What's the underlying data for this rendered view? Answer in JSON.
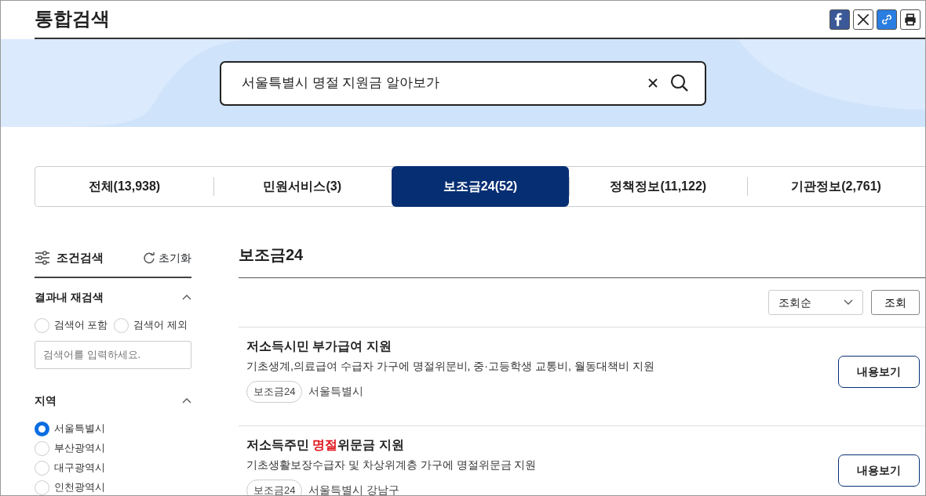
{
  "page_title": "통합검색",
  "share_buttons": [
    {
      "kind": "facebook"
    },
    {
      "kind": "x"
    },
    {
      "kind": "link"
    },
    {
      "kind": "print"
    }
  ],
  "search": {
    "value": "서울특별시 명절 지원금 알아보가"
  },
  "tabs": [
    {
      "label": "전체(13,938)",
      "selected": false
    },
    {
      "label": "민원서비스(3)",
      "selected": false
    },
    {
      "label": "보조금24(52)",
      "selected": true
    },
    {
      "label": "정책정보(11,122)",
      "selected": false
    },
    {
      "label": "기관정보(2,761)",
      "selected": false
    }
  ],
  "filter": {
    "title": "조건검색",
    "reset": "초기화",
    "sections": [
      {
        "title": "결과내 재검색",
        "expanded": true,
        "kind": "search",
        "options": [
          {
            "label": "검색어 포함",
            "selected": false
          },
          {
            "label": "검색어 제외",
            "selected": false
          }
        ],
        "placeholder": "검색어를 입력하세요."
      },
      {
        "title": "지역",
        "expanded": true,
        "kind": "list",
        "options": [
          {
            "label": "서울특별시",
            "selected": true
          },
          {
            "label": "부산광역시",
            "selected": false
          },
          {
            "label": "대구광역시",
            "selected": false
          },
          {
            "label": "인천광역시",
            "selected": false
          }
        ]
      }
    ]
  },
  "results": {
    "heading": "보조금24",
    "sort": "조회순",
    "sort_button": "조회",
    "items": [
      {
        "title": [
          {
            "text": "저소득시민 부가급여 지원",
            "highlight": false
          }
        ],
        "description": "기초생계,의료급여 수급자 가구에 명절위문비, 중·고등학생 교통비, 월동대책비 지원",
        "tag": "보조금24",
        "region": "서울특별시",
        "button": "내용보기"
      },
      {
        "title": [
          {
            "text": "저소득주민 ",
            "highlight": false
          },
          {
            "text": "명절",
            "highlight": true
          },
          {
            "text": "위문금 지원",
            "highlight": false
          }
        ],
        "description": "기초생활보장수급자 및 차상위계층 가구에 명절위문금 지원",
        "tag": "보조금24",
        "region": "서울특별시 강남구",
        "button": "내용보기"
      }
    ]
  }
}
